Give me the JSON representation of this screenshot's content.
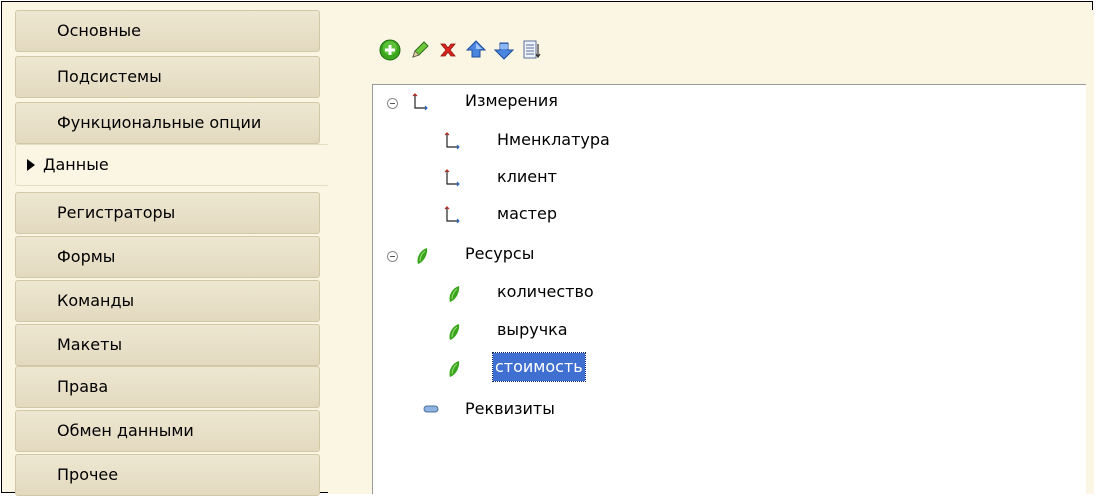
{
  "tabs": [
    {
      "label": "Основные"
    },
    {
      "label": "Подсистемы"
    },
    {
      "label": "Функциональные опции"
    },
    {
      "label": "Данные",
      "active": true
    },
    {
      "label": "Регистраторы"
    },
    {
      "label": "Формы"
    },
    {
      "label": "Команды"
    },
    {
      "label": "Макеты"
    },
    {
      "label": "Права"
    },
    {
      "label": "Обмен данными"
    },
    {
      "label": "Прочее"
    }
  ],
  "toolbar": {
    "icons": [
      "add-icon",
      "edit-icon",
      "delete-icon",
      "move-up-icon",
      "move-down-icon",
      "sort-list-icon"
    ]
  },
  "tree": {
    "dimensions": {
      "label": "Измерения",
      "icon": "dimension-icon",
      "expanded": true
    },
    "dimension_items": [
      {
        "label": "Нменклатура"
      },
      {
        "label": "клиент"
      },
      {
        "label": "мастер"
      }
    ],
    "resources": {
      "label": "Ресурсы",
      "icon": "resource-icon",
      "expanded": true
    },
    "resource_items": [
      {
        "label": "количество"
      },
      {
        "label": "выручка"
      },
      {
        "label": "стоимость",
        "selected": true
      }
    ],
    "attributes": {
      "label": "Реквизиты",
      "icon": "attribute-icon"
    }
  },
  "colors": {
    "panel_bg": "#fbf6e4",
    "selection": "#3f6fd0",
    "resource_green": "#3aa51d",
    "delete_red": "#e0261e",
    "arrow_blue": "#4a86e0"
  }
}
